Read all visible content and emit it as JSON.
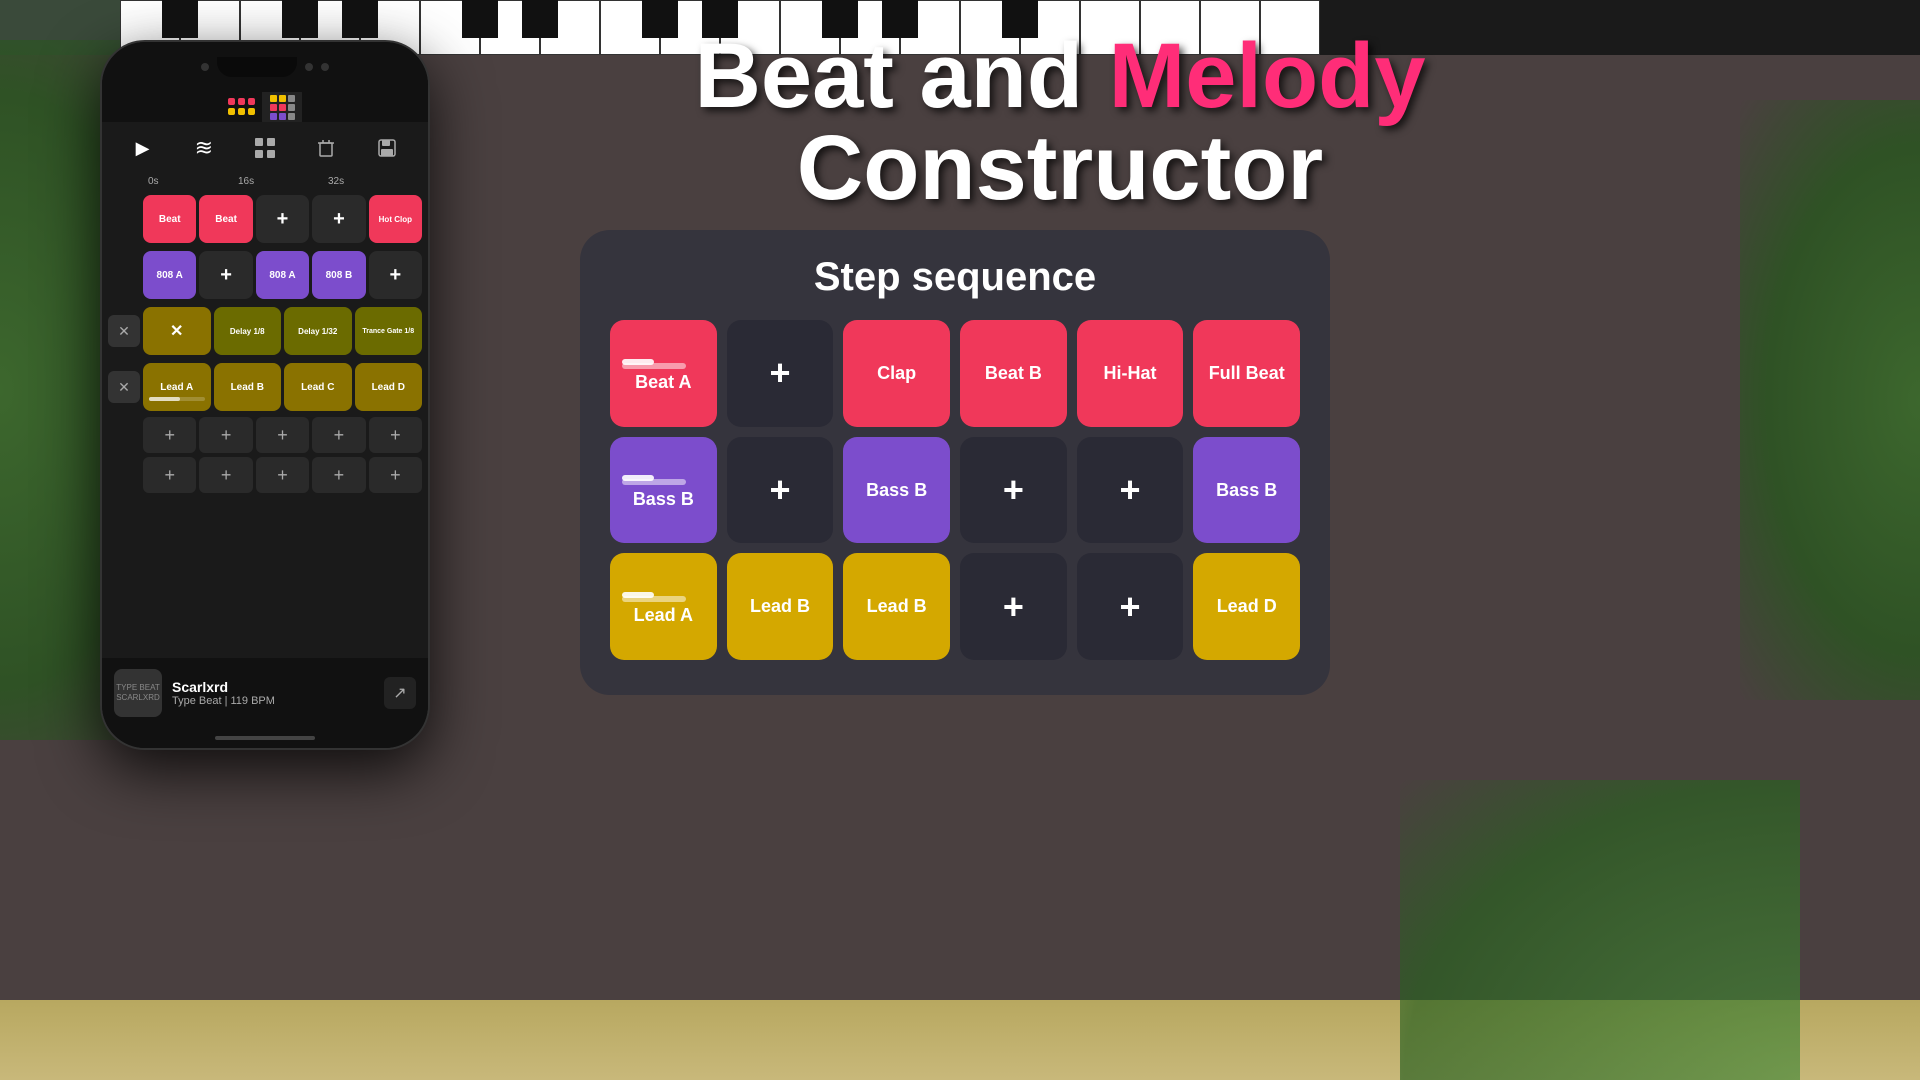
{
  "background": {
    "color": "#4a4040"
  },
  "title": {
    "line1_part1": "Beat and ",
    "line1_melody": "Melody",
    "line2": "Constructor"
  },
  "step_panel": {
    "title": "Step sequence",
    "rows": [
      [
        {
          "label": "Beat A",
          "type": "red",
          "has_slider": true
        },
        {
          "label": "+",
          "type": "dark"
        },
        {
          "label": "Clap",
          "type": "red"
        },
        {
          "label": "Beat B",
          "type": "red"
        },
        {
          "label": "Hi-Hat",
          "type": "red"
        },
        {
          "label": "Full Beat",
          "type": "red"
        }
      ],
      [
        {
          "label": "Bass B",
          "type": "purple",
          "has_slider": true
        },
        {
          "label": "+",
          "type": "dark"
        },
        {
          "label": "Bass B",
          "type": "purple"
        },
        {
          "label": "+",
          "type": "dark"
        },
        {
          "label": "+",
          "type": "dark"
        },
        {
          "label": "Bass B",
          "type": "purple"
        }
      ],
      [
        {
          "label": "Lead A",
          "type": "yellow",
          "has_slider": true
        },
        {
          "label": "Lead B",
          "type": "yellow"
        },
        {
          "label": "Lead B",
          "type": "yellow"
        },
        {
          "label": "+",
          "type": "dark"
        },
        {
          "label": "+",
          "type": "dark"
        },
        {
          "label": "Lead D",
          "type": "yellow"
        }
      ]
    ]
  },
  "phone": {
    "toolbar": {
      "play": "▶",
      "waves": "≋",
      "grid": "⊞",
      "trash": "🗑",
      "save": "💾"
    },
    "timeline_labels": [
      "0s",
      "",
      "16s",
      "",
      "32s"
    ],
    "rows": [
      {
        "has_x": false,
        "cells": [
          {
            "label": "Beat",
            "type": "red"
          },
          {
            "label": "Beat",
            "type": "red"
          },
          {
            "label": "+",
            "type": "dark-cell"
          },
          {
            "label": "+",
            "type": "dark-cell"
          },
          {
            "label": "Hot Clop",
            "type": "red",
            "small": true
          }
        ]
      },
      {
        "has_x": false,
        "cells": [
          {
            "label": "808 A",
            "type": "purple"
          },
          {
            "label": "+",
            "type": "dark-cell"
          },
          {
            "label": "808 A",
            "type": "purple"
          },
          {
            "label": "808 B",
            "type": "purple"
          },
          {
            "label": "+",
            "type": "dark-cell"
          }
        ]
      },
      {
        "has_x": true,
        "cells": [
          {
            "label": "✕",
            "type": "x-marked"
          },
          {
            "label": "Delay 1/8",
            "type": "olive",
            "small": true
          },
          {
            "label": "Delay 1/32",
            "type": "olive",
            "small": true
          },
          {
            "label": "Trance Gate 1/8",
            "type": "olive",
            "small": true
          }
        ]
      },
      {
        "has_x": true,
        "cells": [
          {
            "label": "Lead A",
            "type": "yellow-dk",
            "has_slider": true
          },
          {
            "label": "Lead B",
            "type": "yellow-dk",
            "has_slider": false
          },
          {
            "label": "Lead C",
            "type": "yellow-dk",
            "has_slider": false
          },
          {
            "label": "Lead D",
            "type": "yellow-dk",
            "has_slider": false
          }
        ]
      }
    ],
    "add_rows": 2,
    "player": {
      "name": "Scarlxrd",
      "subtitle": "Type Beat | 119 BPM",
      "thumb_text": "TYPE BEAT\nSCARLXRD"
    }
  },
  "icons": {
    "play": "▶",
    "plus": "+",
    "x": "✕",
    "export": "↗"
  }
}
